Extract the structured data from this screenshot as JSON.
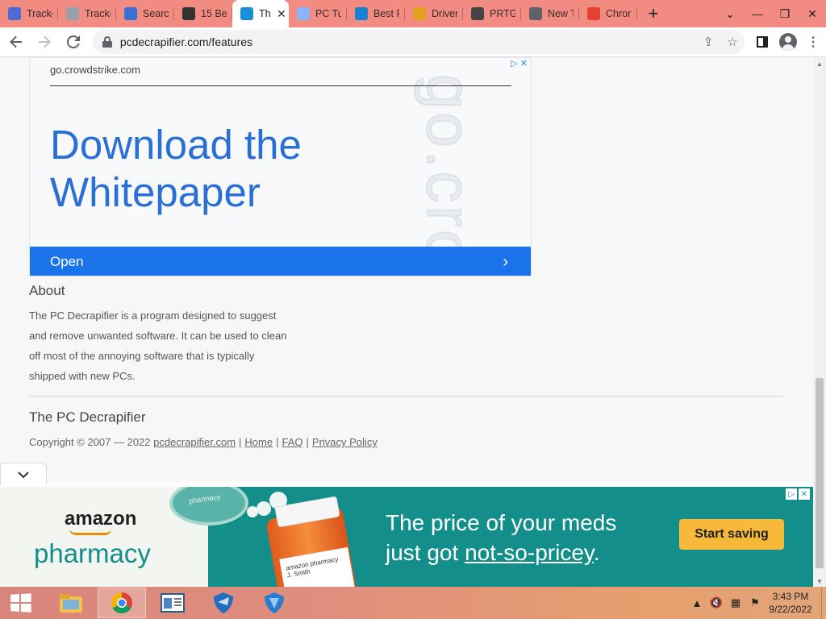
{
  "browser": {
    "tabs": [
      {
        "title": "Tracke",
        "icon": "pirate-favicon",
        "color": "#4a6cd4"
      },
      {
        "title": "Tracke",
        "icon": "search-favicon",
        "color": "#9aa0a6"
      },
      {
        "title": "Searcl",
        "icon": "shield-favicon",
        "color": "#3b6fd4"
      },
      {
        "title": "15 Be",
        "icon": "p-favicon",
        "color": "#333333"
      },
      {
        "title": "Th",
        "icon": "pcd-favicon",
        "color": "#1a8fd4",
        "active": true
      },
      {
        "title": "PC Tu",
        "icon": "gear-favicon",
        "color": "#8ab4f8"
      },
      {
        "title": "Best F",
        "icon": "windows-favicon",
        "color": "#1b7fd4"
      },
      {
        "title": "Driver",
        "icon": "driver-favicon",
        "color": "#e0a020"
      },
      {
        "title": "PRTG",
        "icon": "prtg-favicon",
        "color": "#444444"
      },
      {
        "title": "New T",
        "icon": "chrome-favicon",
        "color": "#5f6368"
      },
      {
        "title": "Chror",
        "icon": "chrome-web-favicon",
        "color": "#e34133"
      }
    ],
    "active_close": "✕",
    "newtab": "+",
    "window": {
      "chevron": "⌄",
      "minimize": "—",
      "restore": "❐",
      "close": "✕"
    },
    "url": "pcdecrapifier.com/features"
  },
  "ad": {
    "domain": "go.crowdstrike.com",
    "watermark": "go.crow",
    "headline": "Download the Whitepaper",
    "cta": "Open",
    "cta_chevron": "›"
  },
  "about": {
    "title": "About",
    "text": "The PC Decrapifier is a program designed to suggest and remove unwanted software. It can be used to clean off most of the annoying software that is typically shipped with new PCs."
  },
  "site": {
    "title": "The PC Decrapifier",
    "copyright": "Copyright © 2007 — 2022",
    "links": [
      "pcdecrapifier.com",
      "Home",
      "FAQ",
      "Privacy Policy"
    ]
  },
  "bottom_ad": {
    "brand_top": "amazon",
    "brand_bottom": "pharmacy",
    "cap_text": "pharmacy",
    "bottle_label": "amazon pharmacy  J. Smith",
    "headline_1": "The price of your meds",
    "headline_2_prefix": "just got ",
    "headline_2_underlined": "not-so-pricey",
    "headline_2_suffix": ".",
    "cta": "Start saving"
  },
  "taskbar": {
    "time": "3:43 PM",
    "date": "9/22/2022"
  }
}
